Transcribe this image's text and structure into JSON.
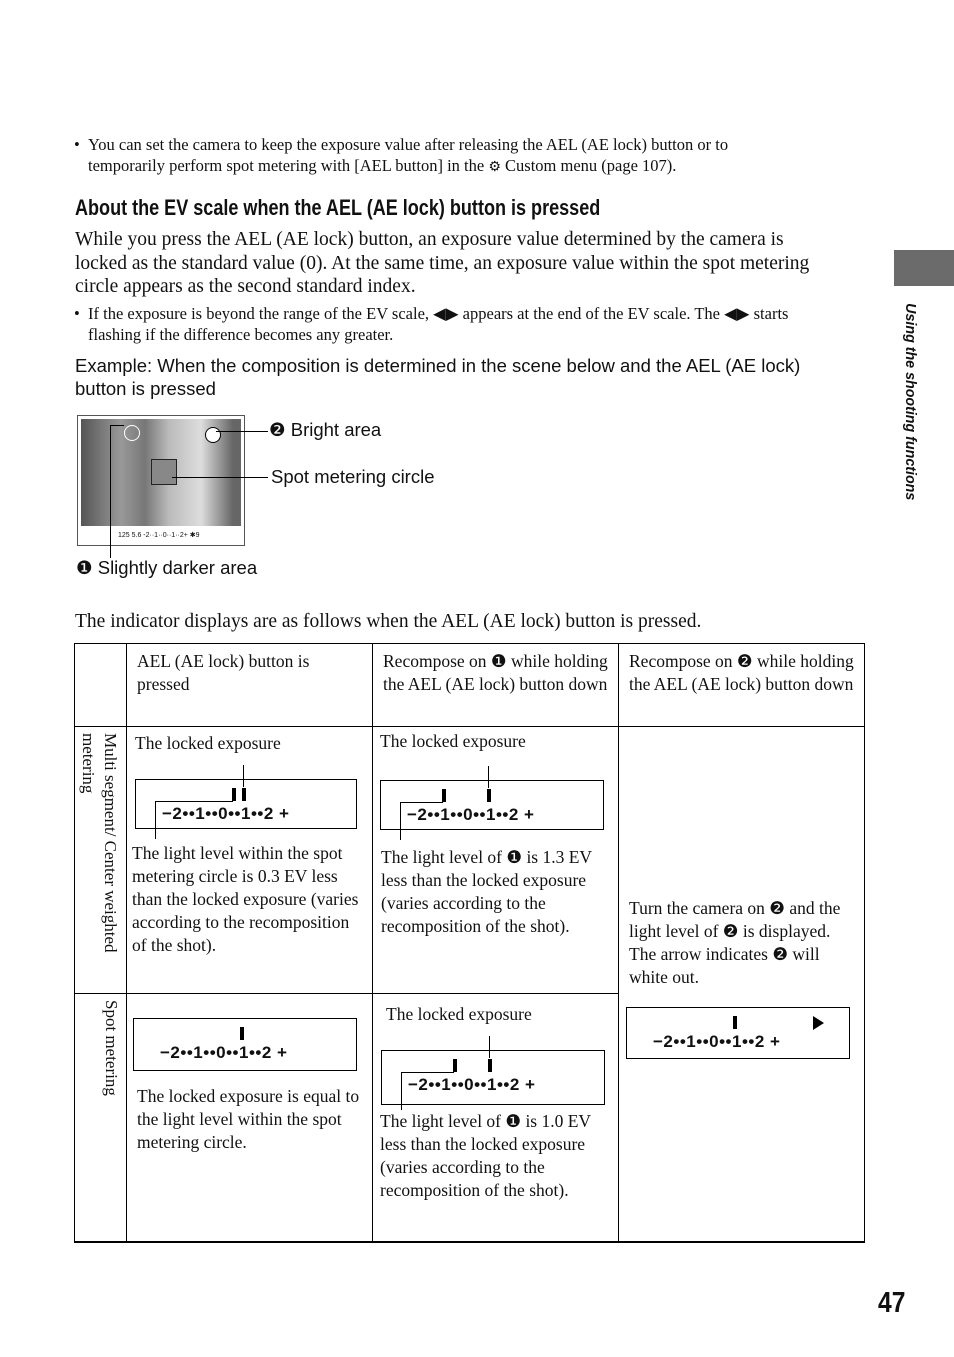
{
  "intro_bullet": {
    "line1": "You can set the camera to keep the exposure value after releasing the AEL (AE lock) button or to",
    "line2a": "temporarily perform spot metering with [AEL button] in the",
    "icon": "gear-icon",
    "line2b": "Custom menu (page 107)."
  },
  "section_title": "About the EV scale when the AEL (AE lock) button is pressed",
  "paragraph": [
    "While you press the AEL (AE lock) button, an exposure value determined by the camera is",
    "locked as the standard value (0). At the same time, an exposure value within the spot metering",
    "circle appears as the second standard index."
  ],
  "bullet2": [
    "If the exposure is beyond the range of the EV scale, ◀▶ appears at the end of the EV scale. The ◀▶ starts",
    "flashing if the difference becomes any greater."
  ],
  "example": [
    "Example: When the composition is determined in the scene below and the AEL (AE lock)",
    "button is pressed"
  ],
  "figure": {
    "label_bright": "❷ Bright area",
    "label_spot": "Spot metering circle",
    "label_dark": "❶ Slightly darker area",
    "viewfinder_readout": "125 5.6  -2··1··0··1··2+ ✱9"
  },
  "table_intro": "The indicator displays are as follows when the AEL (AE lock) button is pressed.",
  "table": {
    "headers": [
      "AEL (AE lock) button is pressed",
      "Recompose on ❶ while holding the AEL (AE lock) button down",
      "Recompose on ❷ while holding the AEL (AE lock) button down"
    ],
    "row_labels": [
      "Multi segment/ Center weighted metering",
      "Spot metering"
    ],
    "ev_scale_text": "−2••1••0••1••2 +",
    "r1c1": {
      "top": "The locked exposure",
      "bottom": "The light level within the spot metering circle is 0.3 EV less than the locked exposure (varies according to the recomposition of the shot).",
      "marks_ev": [
        -0.3,
        0
      ]
    },
    "r1c2": {
      "top": "The locked exposure",
      "bottom": "The light level of ❶ is 1.3 EV less than the locked exposure (varies according to the recomposition of the shot).",
      "marks_ev": [
        -1.3,
        0
      ]
    },
    "c3": {
      "text": "Turn the camera on ❷ and the light level of ❷ is displayed. The arrow indicates ❷ will white out.",
      "marks_ev": [
        0
      ],
      "arrow": "right"
    },
    "r2c1": {
      "bottom": "The locked exposure is equal to the light level within the spot metering circle.",
      "marks_ev": [
        0
      ]
    },
    "r2c2": {
      "top": "The locked exposure",
      "bottom": "The light level of ❶ is 1.0 EV less than the locked exposure (varies according to the recomposition of the shot).",
      "marks_ev": [
        -1.0,
        0
      ]
    }
  },
  "side_tab": "Using the shooting functions",
  "page_number": "47"
}
